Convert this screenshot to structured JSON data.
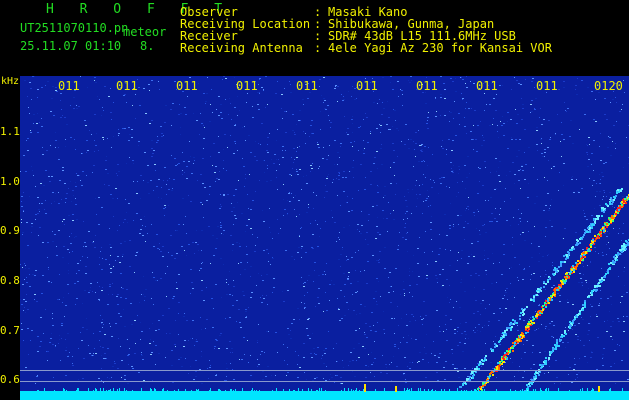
{
  "header": {
    "title": "H R O F F T",
    "filename": "UT2511070110.pn",
    "mode": "meteor",
    "date": "25.11.07 01:10",
    "count": "8.",
    "rows": [
      {
        "label": "Observer",
        "sep": ":",
        "value": "Masaki Kano"
      },
      {
        "label": "Receiving Location",
        "sep": ":",
        "value": "Shibukawa, Gunma, Japan"
      },
      {
        "label": "Receiver",
        "sep": ":",
        "value": "SDR# 43dB L15 111.6MHz USB"
      },
      {
        "label": "Receiving Antenna",
        "sep": ":",
        "value": "4ele Yagi Az 230 for Kansai VOR"
      }
    ]
  },
  "yaxis": {
    "unit": "kHz",
    "ticks": [
      "1.1",
      "1.0",
      "0.9",
      "0.8",
      "0.7",
      "0.6"
    ]
  },
  "xaxis": {
    "ticks": [
      "011",
      "011",
      "011",
      "011",
      "011",
      "011",
      "011",
      "011",
      "011",
      "0120"
    ]
  },
  "colors": {
    "background": "#0a1fa0",
    "header_text": "#22dd22",
    "axis_text": "#f0f000",
    "noise_floor": "#00e5ff"
  }
}
